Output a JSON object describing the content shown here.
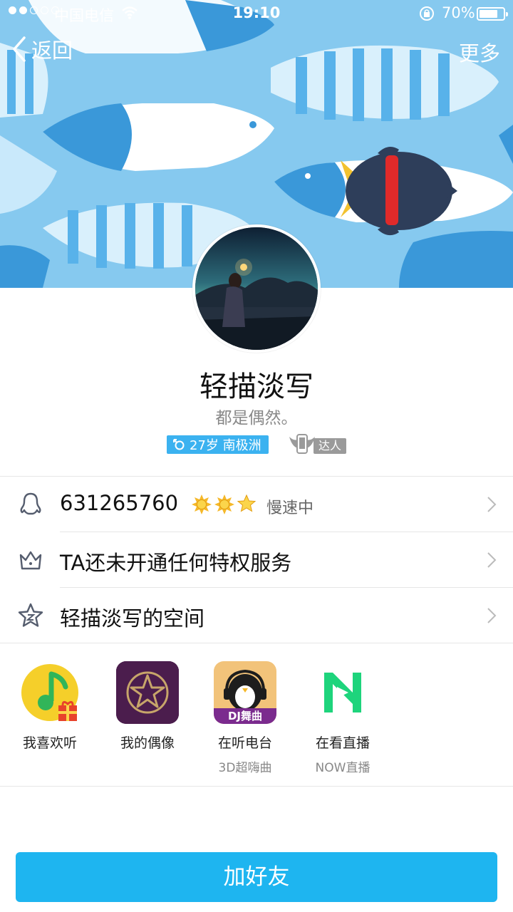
{
  "status_bar": {
    "carrier": "中国电信",
    "time": "19:10",
    "battery": "70%",
    "battery_level": 0.7,
    "signal_dots_filled": 2,
    "signal_dots_total": 5
  },
  "nav": {
    "back_label": "返回",
    "more_label": "更多"
  },
  "profile": {
    "name": "轻描淡写",
    "signature": "都是偶然。",
    "info_badge": "27岁 南极洲",
    "daren_label": "达人"
  },
  "rows": {
    "qq_number": "631265760",
    "qq_status": "慢速中",
    "privilege": "TA还未开通任何特权服务",
    "space": "轻描淡写的空间"
  },
  "apps": [
    {
      "name": "我喜欢听",
      "subtitle": ""
    },
    {
      "name": "我的偶像",
      "subtitle": ""
    },
    {
      "name": "在听电台",
      "subtitle": "3D超嗨曲",
      "badge": "DJ舞曲"
    },
    {
      "name": "在看直播",
      "subtitle": "NOW直播"
    }
  ],
  "add_friend_label": "加好友",
  "colors": {
    "accent": "#1eb5f0",
    "badge_blue": "#3bb2f0",
    "header_sky": "#86c9ef"
  },
  "icons": [
    "chevron-left-icon",
    "wifi-icon",
    "lock-rotation-icon",
    "penguin-icon",
    "crown-icon",
    "star-icon",
    "chevron-right-icon",
    "sun-level-icon"
  ]
}
